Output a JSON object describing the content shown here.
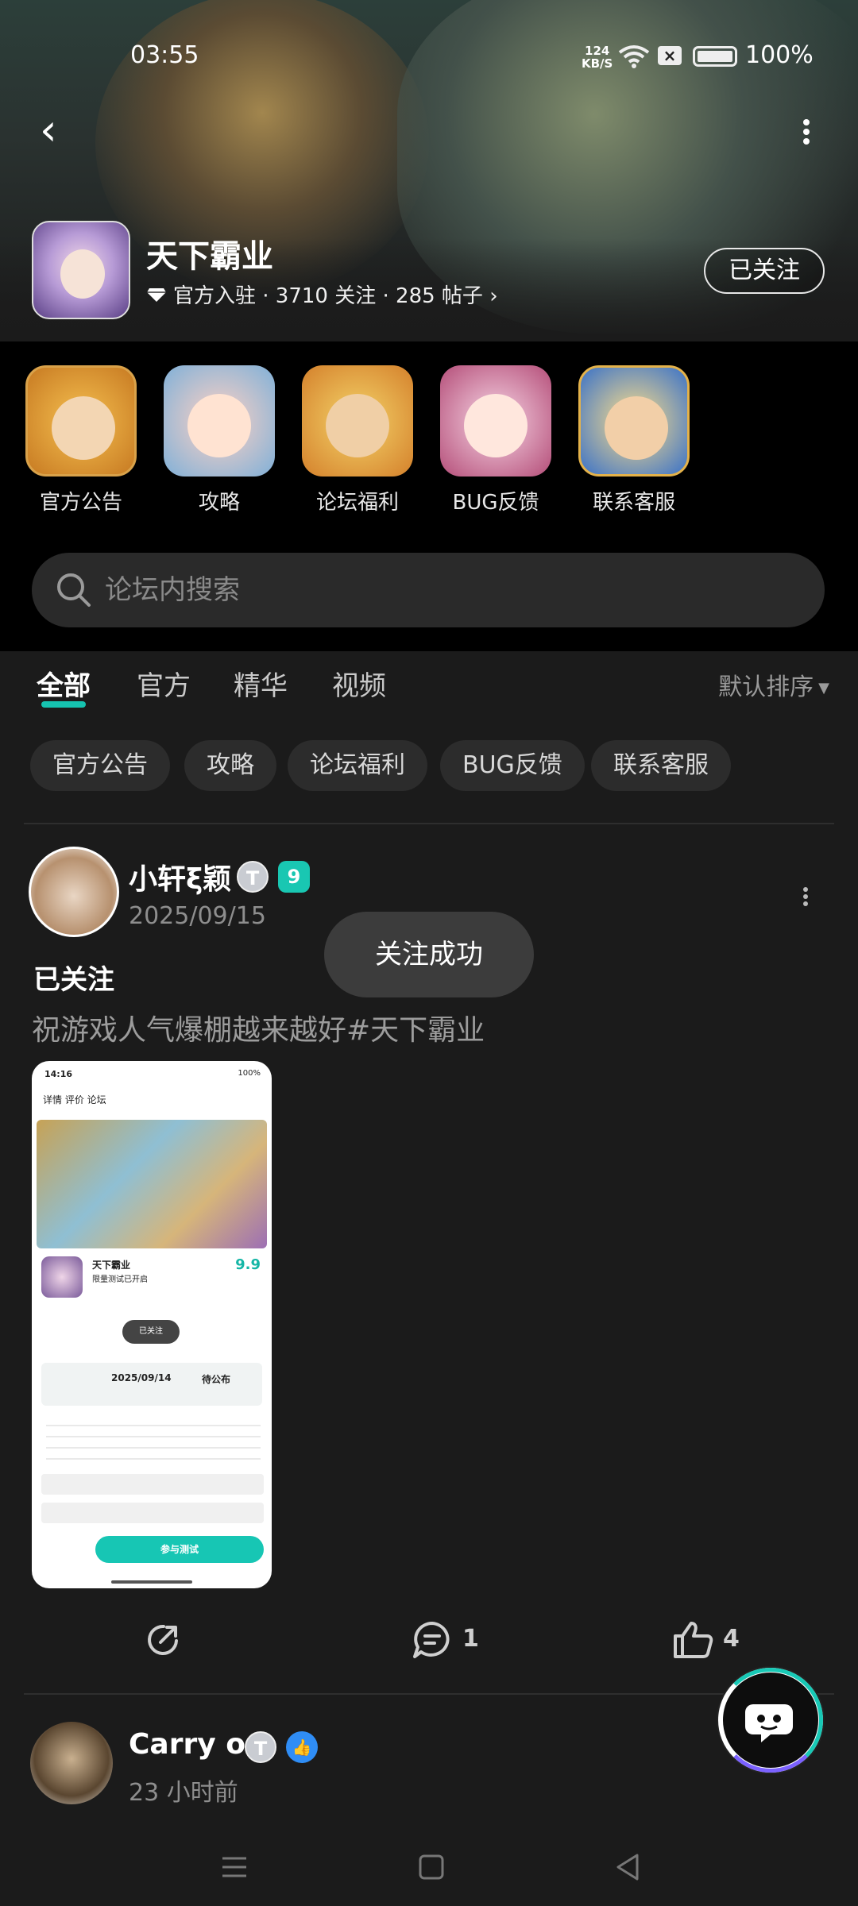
{
  "status": {
    "time": "03:55",
    "speed_value": "124",
    "speed_unit": "KB/S",
    "battery": "100%"
  },
  "forum": {
    "title": "天下霸业",
    "meta": "官方入驻 · 3710 关注 · 285 帖子",
    "follow_label": "已关注"
  },
  "shortcuts": [
    {
      "label": "官方公告"
    },
    {
      "label": "攻略"
    },
    {
      "label": "论坛福利"
    },
    {
      "label": "BUG反馈"
    },
    {
      "label": "联系客服"
    }
  ],
  "search": {
    "placeholder": "论坛内搜索"
  },
  "tabs": [
    "全部",
    "官方",
    "精华",
    "视频"
  ],
  "sort_label": "默认排序",
  "chips": [
    "官方公告",
    "攻略",
    "论坛福利",
    "BUG反馈",
    "联系客服"
  ],
  "post": {
    "author": "小轩ξ颖",
    "level": "9",
    "date": "2025/09/15",
    "status": "已关注",
    "text": "祝游戏人气爆棚越来越好#天下霸业",
    "comments": "1",
    "likes": "4"
  },
  "toast": "关注成功",
  "embedded": {
    "time": "14:16",
    "status": "100%",
    "nav": "详情 评价 论坛",
    "game_name": "天下霸业",
    "game_sub": "限量测试已开启",
    "score": "9.9",
    "mini_toast": "已关注",
    "test_date": "2025/09/14",
    "pending": "待公布",
    "join": "参与测试"
  },
  "post2": {
    "author": "Carry on",
    "date": "23 小时前"
  }
}
